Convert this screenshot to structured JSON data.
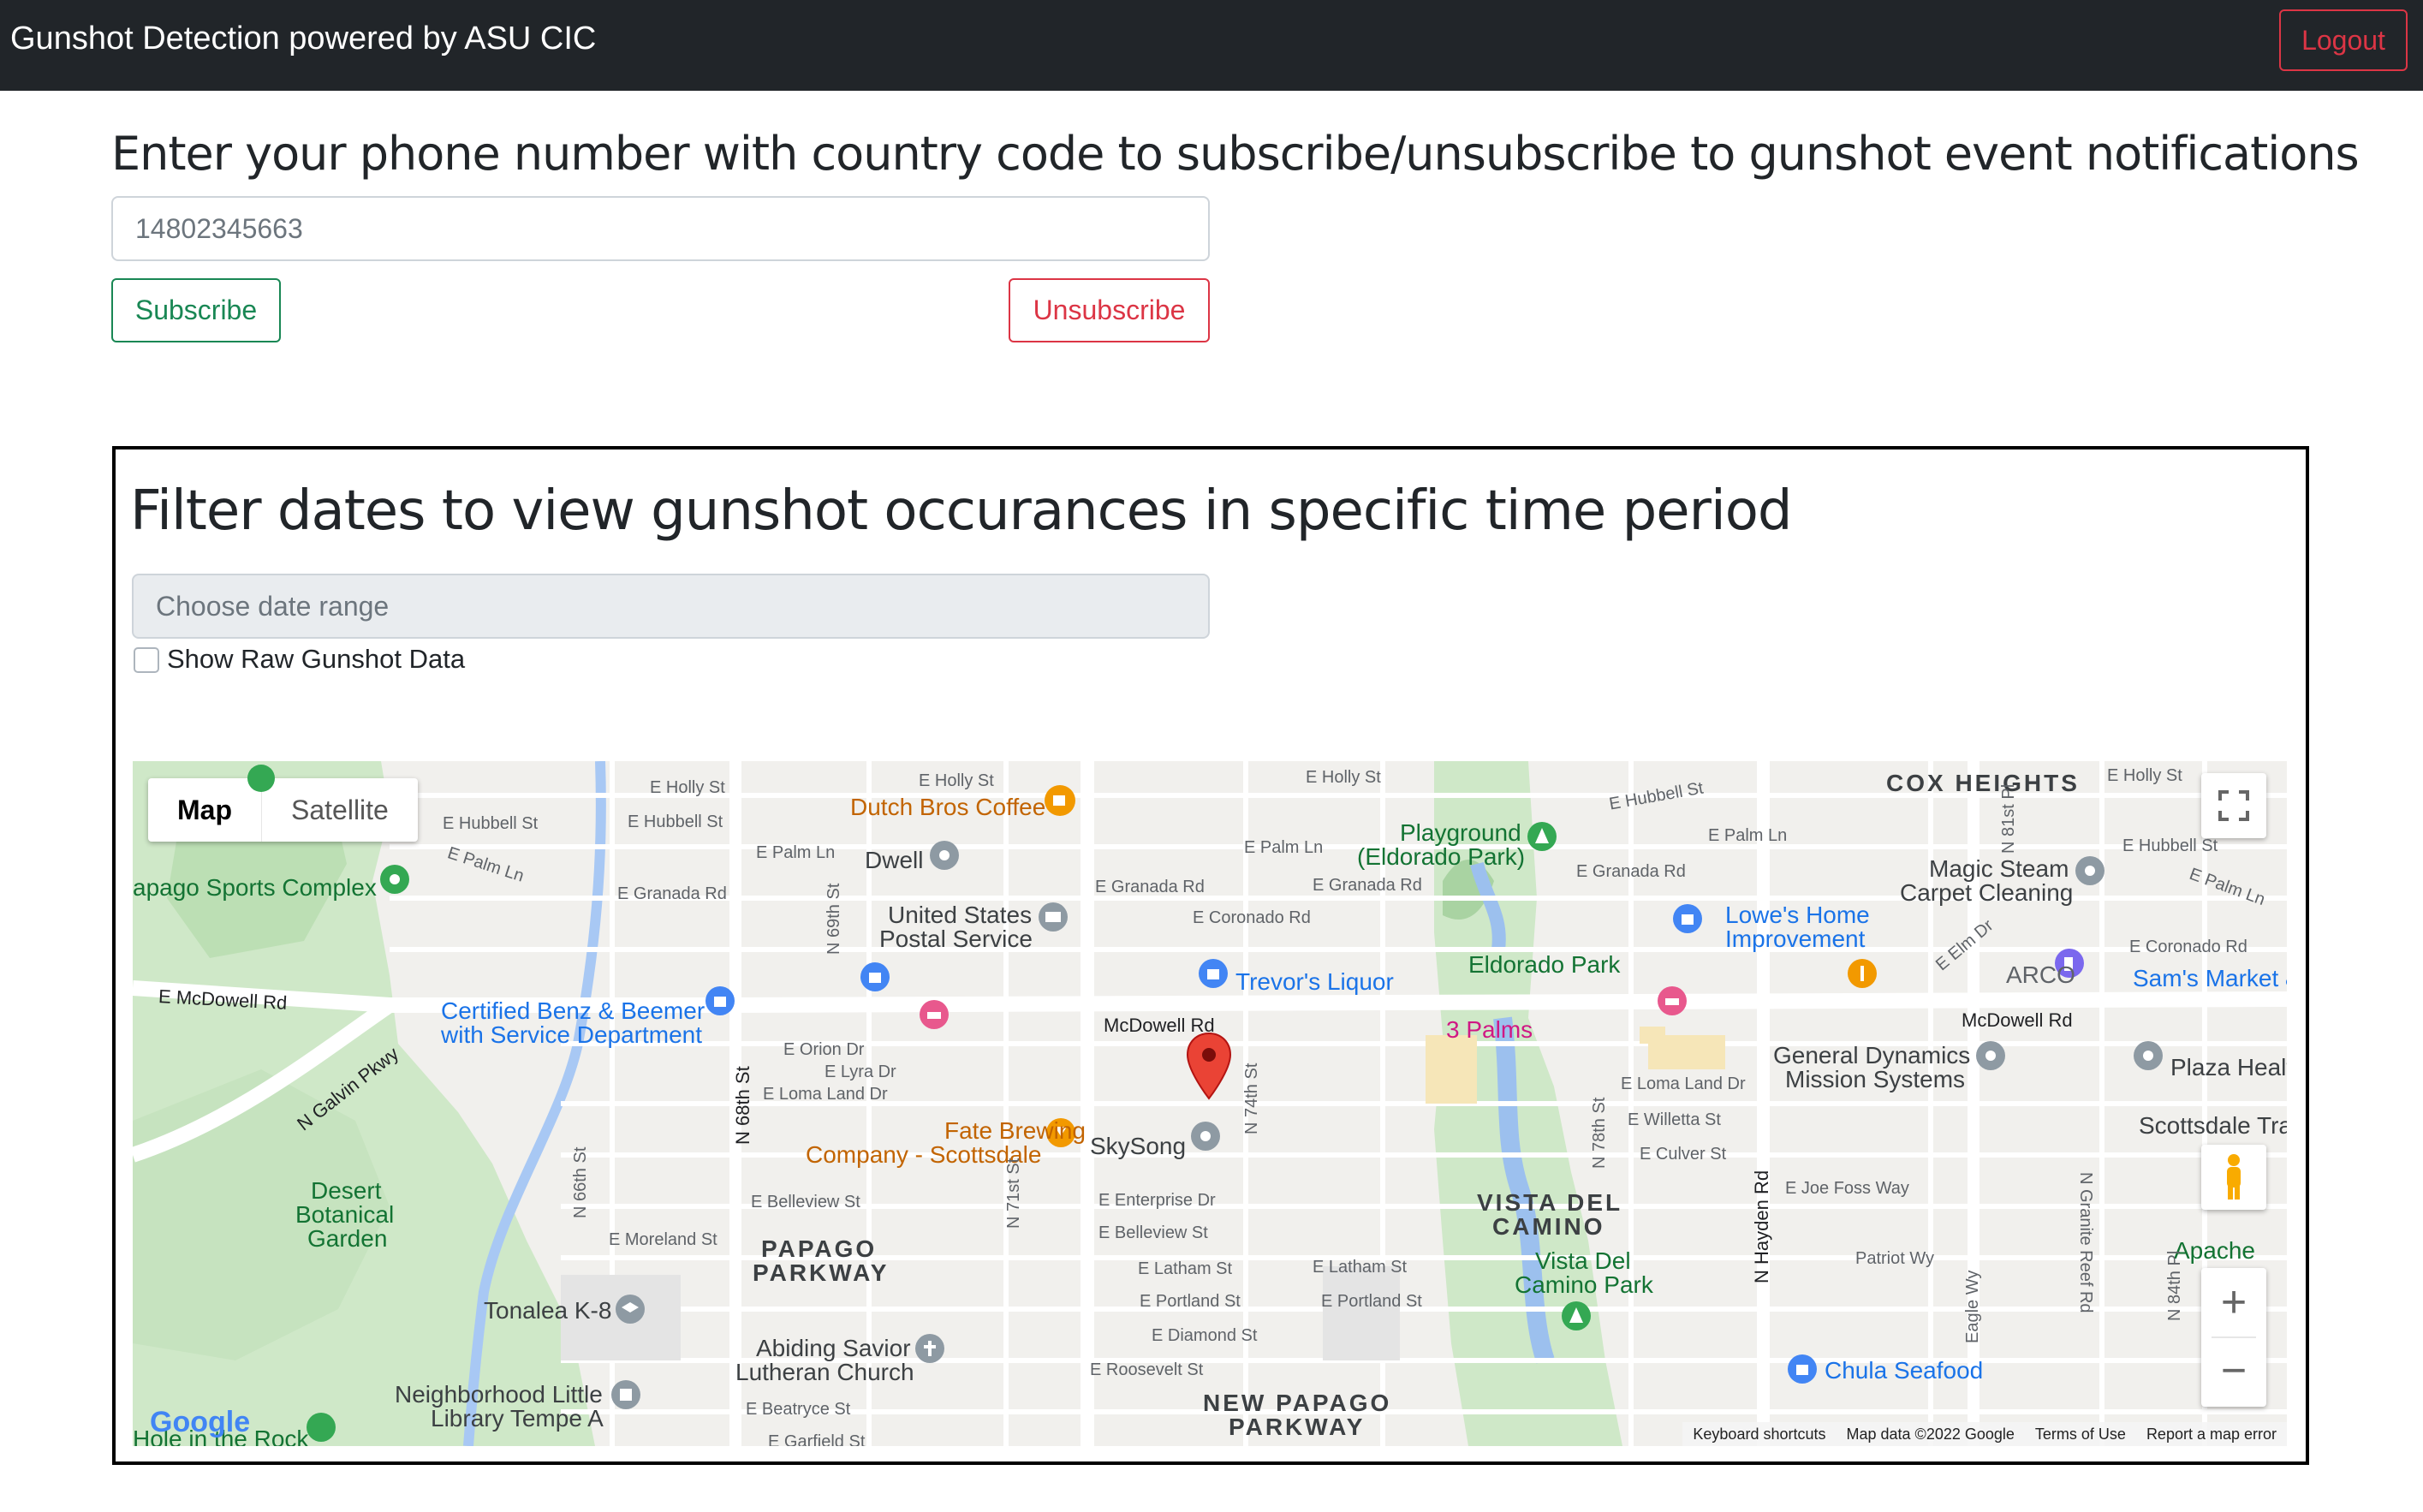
{
  "navbar": {
    "brand": "Gunshot Detection powered by ASU CIC",
    "logout_label": "Logout"
  },
  "subscribe": {
    "heading": "Enter your phone number with country code to subscribe/unsubscribe to gunshot event notifications",
    "phone_placeholder": "14802345663",
    "subscribe_label": "Subscribe",
    "unsubscribe_label": "Unsubscribe"
  },
  "filter": {
    "heading": "Filter dates to view gunshot occurances in specific time period",
    "date_placeholder": "Choose date range",
    "raw_label": "Show Raw Gunshot Data"
  },
  "map": {
    "map_type": {
      "map_label": "Map",
      "satellite_label": "Satellite"
    },
    "attribution": {
      "keyboard": "Keyboard shortcuts",
      "data": "Map data ©2022 Google",
      "terms": "Terms of Use",
      "report": "Report a map error"
    },
    "logo": "Google",
    "areas": {
      "cox": "COX HEIGHTS",
      "vista1": "VISTA DEL",
      "vista2": "CAMINO",
      "papago1": "PAPAGO",
      "papago2": "PARKWAY",
      "newpapago1": "NEW PAPAGO",
      "newpapago2": "PARKWAY"
    },
    "roads": {
      "mcdowell_w": "E McDowell Rd",
      "mcdowell_c": "McDowell Rd",
      "mcdowell_e": "McDowell Rd",
      "galvin": "N Galvin Pkwy",
      "hayden": "N Hayden Rd",
      "n68th": "N 68th St"
    },
    "pois": {
      "dutch": "Dutch Bros Coffee",
      "dwell": "Dwell",
      "usps1": "United States",
      "usps2": "Postal Service",
      "papago_sports": "apago Sports Complex",
      "benz1": "Certified Benz & Beemer",
      "benz2": "with Service Department",
      "trevors": "Trevor's Liquor",
      "playground1": "Playground",
      "playground2": "(Eldorado Park)",
      "eldorado": "Eldorado Park",
      "lowes1": "Lowe's Home",
      "lowes2": "Improvement",
      "magic1": "Magic Steam",
      "magic2": "Carpet Cleaning",
      "arco": "ARCO",
      "sams": "Sam's Market &",
      "palms": "3 Palms",
      "gd1": "General Dynamics",
      "gd2": "Mission Systems",
      "plaza": "Plaza Healt",
      "scottsdale_tra": "Scottsdale Tra",
      "fate1": "Fate Brewing",
      "fate2": "Company - Scottsdale",
      "skysong": "SkySong",
      "desert1": "Desert",
      "desert2": "Botanical",
      "desert3": "Garden",
      "tonalea": "Tonalea K-8",
      "abiding1": "Abiding Savior",
      "abiding2": "Lutheran Church",
      "library1": "Neighborhood Little",
      "library2": "Library Tempe A",
      "vistapark1": "Vista Del",
      "vistapark2": "Camino Park",
      "chula": "Chula Seafood",
      "apache": "Apache",
      "hole": "Hole in the Rock"
    },
    "streets": {
      "holly1": "E Holly St",
      "holly2": "E Holly St",
      "holly3": "E Holly St",
      "holly4": "E Holly St",
      "hubbell1": "E Hubbell St",
      "hubbell2": "E Hubbell St",
      "hubbell3": "E Hubbell St",
      "hubbell4": "E Hubbell St",
      "palm1": "E Palm Ln",
      "palm2": "E Palm Ln",
      "palm3": "E Palm Ln",
      "palm4": "E Palm Ln",
      "palm5": "E Palm Ln",
      "granada1": "E Granada Rd",
      "granada2": "E Granada Rd",
      "granada3": "E Granada Rd",
      "granada4": "E Granada Rd",
      "coronado1": "E Coronado Rd",
      "coronado2": "E Coronado Rd",
      "orion": "E Orion Dr",
      "lyra": "E Lyra Dr",
      "loma1": "E Loma Land Dr",
      "loma2": "E Loma Land Dr",
      "willetta": "E Willetta St",
      "culver": "E Culver St",
      "joefoss": "E Joe Foss Way",
      "patriot": "Patriot Wy",
      "belleview1": "E Belleview St",
      "belleview2": "E Belleview St",
      "enterprise": "E Enterprise Dr",
      "moreland": "E Moreland St",
      "latham1": "E Latham St",
      "latham2": "E Latham St",
      "portland1": "E Portland St",
      "portland2": "E Portland St",
      "diamond": "E Diamond St",
      "roosevelt": "E Roosevelt St",
      "beatryce": "E Beatryce St",
      "garfield": "E Garfield St",
      "n69th": "N 69th St",
      "n71st": "N 71st St",
      "n74th": "N 74th St",
      "n78th": "N 78th St",
      "n66th": "N 66th St",
      "granite": "N Granite Reef Rd",
      "n84th": "N 84th Pl",
      "eagle": "Eagle Wy",
      "n81st": "N 81st Pl",
      "elm": "E Elm Dr"
    }
  }
}
